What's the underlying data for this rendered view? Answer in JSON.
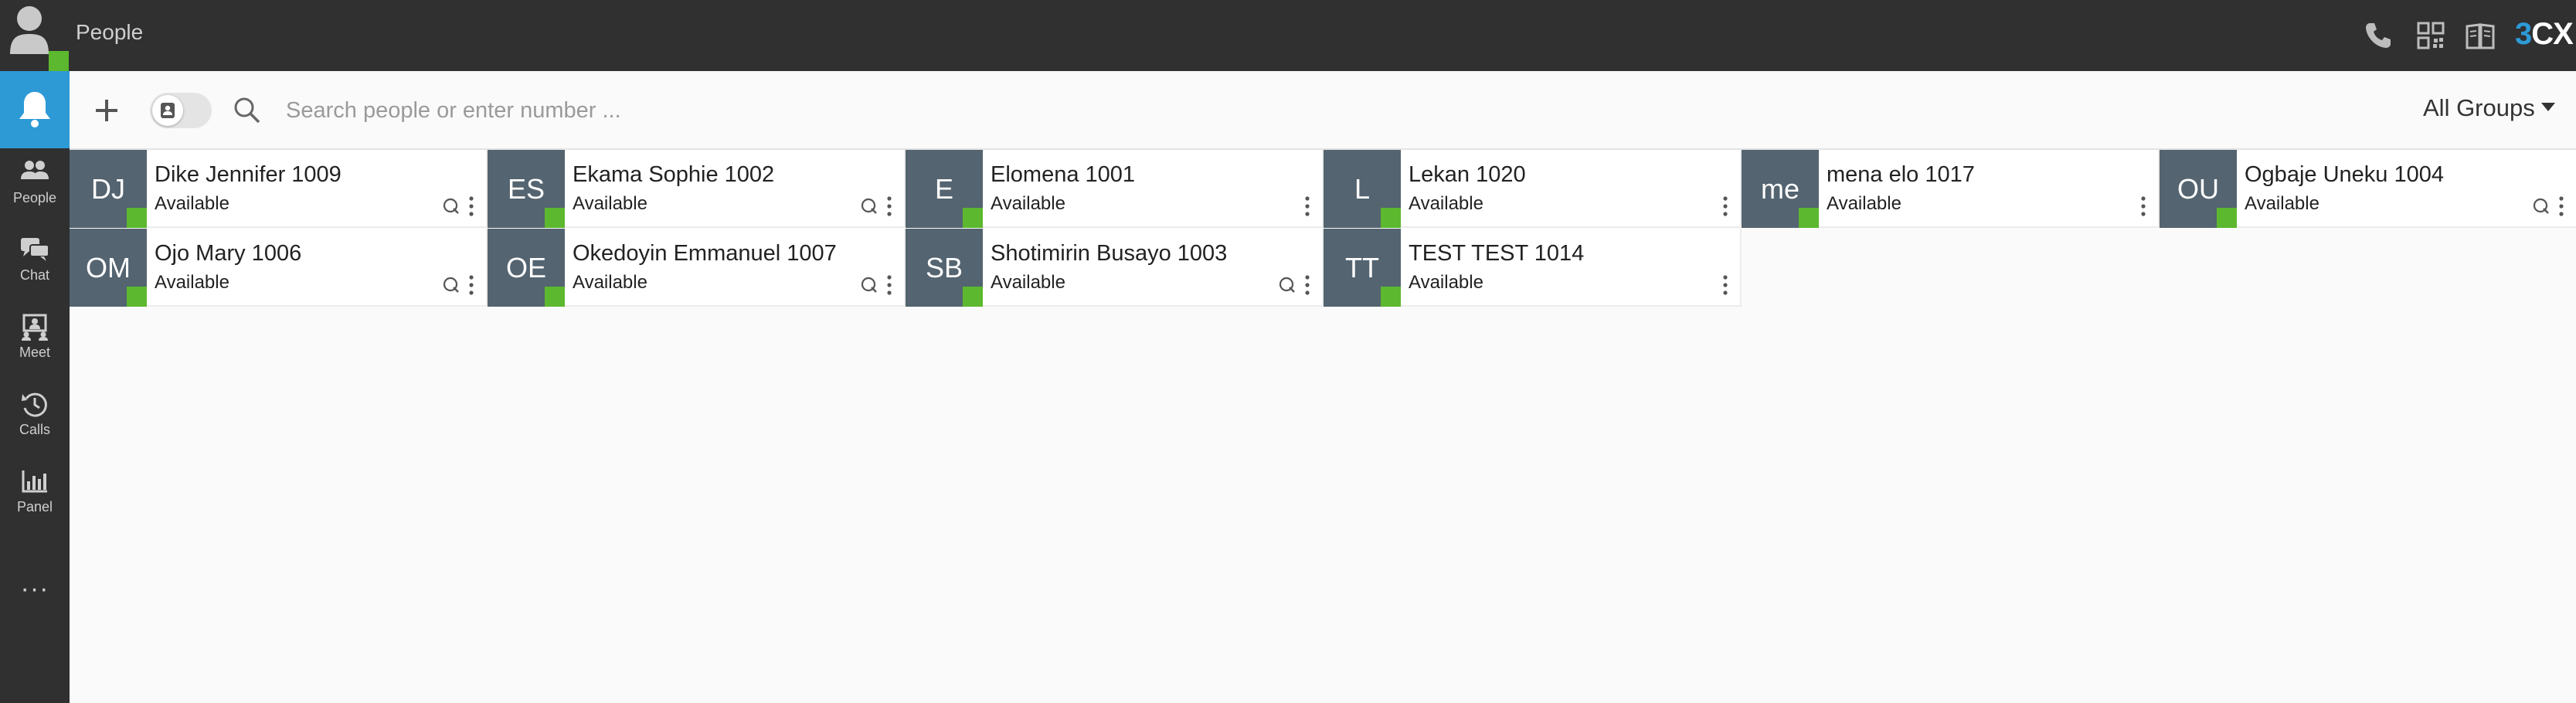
{
  "app": {
    "title": "People",
    "brand_prefix": "3",
    "brand_suffix": "CX"
  },
  "top_icons": [
    "phone-icon",
    "qr-code-icon",
    "book-icon"
  ],
  "sidebar": {
    "items": [
      {
        "label": "People",
        "icon": "people-icon"
      },
      {
        "label": "Chat",
        "icon": "chat-icon"
      },
      {
        "label": "Meet",
        "icon": "meet-icon"
      },
      {
        "label": "Calls",
        "icon": "history-icon"
      },
      {
        "label": "Panel",
        "icon": "chart-icon"
      }
    ],
    "more": "···"
  },
  "toolbar": {
    "search_placeholder": "Search people or enter number ...",
    "group_filter": "All Groups"
  },
  "contacts": [
    {
      "initials": "DJ",
      "name": "Dike Jennifer 1009",
      "status": "Available",
      "has_q": true
    },
    {
      "initials": "ES",
      "name": "Ekama Sophie 1002",
      "status": "Available",
      "has_q": true
    },
    {
      "initials": "E",
      "name": "Elomena 1001",
      "status": "Available",
      "has_q": false
    },
    {
      "initials": "L",
      "name": "Lekan 1020",
      "status": "Available",
      "has_q": false
    },
    {
      "initials": "me",
      "name": "mena elo 1017",
      "status": "Available",
      "has_q": false
    },
    {
      "initials": "OU",
      "name": "Ogbaje Uneku 1004",
      "status": "Available",
      "has_q": true
    },
    {
      "initials": "OM",
      "name": "Ojo Mary 1006",
      "status": "Available",
      "has_q": true
    },
    {
      "initials": "OE",
      "name": "Okedoyin Emmanuel 1007",
      "status": "Available",
      "has_q": true
    },
    {
      "initials": "SB",
      "name": "Shotimirin Busayo 1003",
      "status": "Available",
      "has_q": true
    },
    {
      "initials": "TT",
      "name": "TEST TEST 1014",
      "status": "Available",
      "has_q": false
    }
  ],
  "colors": {
    "accent": "#2d9ad6",
    "available": "#5cb82e",
    "avatar_bg": "#546470",
    "topbar": "#303030"
  }
}
